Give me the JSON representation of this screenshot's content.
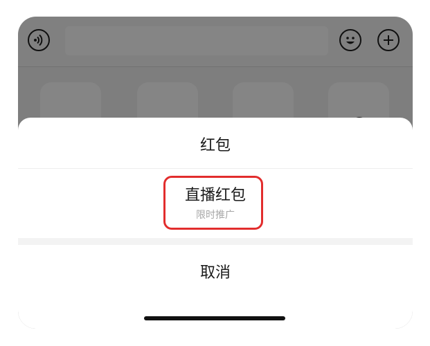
{
  "chat_bar": {
    "voice_icon": "voice-icon",
    "emoji_icon": "emoji-icon",
    "plus_icon": "plus-icon"
  },
  "tools": [
    {
      "icon": "photo-icon"
    },
    {
      "icon": "camera-icon"
    },
    {
      "icon": "video-call-icon"
    },
    {
      "icon": "location-icon"
    }
  ],
  "action_sheet": {
    "red_packet": "红包",
    "live_red_packet": "直播红包",
    "live_red_packet_sub": "限时推广",
    "cancel": "取消"
  },
  "colors": {
    "highlight": "#e22d2d",
    "overlay": "rgba(0,0,0,0.48)"
  }
}
